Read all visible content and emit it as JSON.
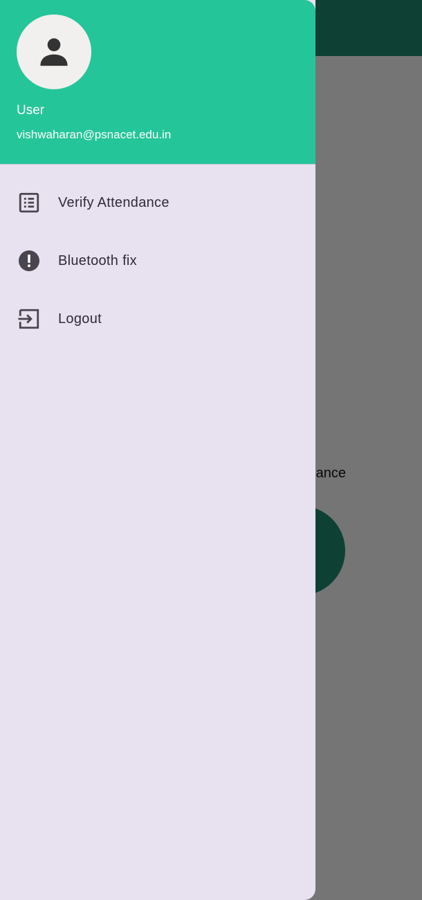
{
  "background": {
    "partial_text": "ance"
  },
  "drawer": {
    "header": {
      "avatar_icon": "person-icon",
      "user_name": "User",
      "email": "vishwaharan@psnacet.edu.in"
    },
    "items": [
      {
        "label": "Verify Attendance",
        "icon": "list-alt-icon"
      },
      {
        "label": "Bluetooth fix",
        "icon": "error-icon"
      },
      {
        "label": "Logout",
        "icon": "exit-to-app-icon"
      }
    ]
  },
  "colors": {
    "header_green": "#25c59a",
    "appbar_green": "#1f8f70",
    "drawer_background": "#e8e1f0",
    "icon_color": "#49454f"
  }
}
